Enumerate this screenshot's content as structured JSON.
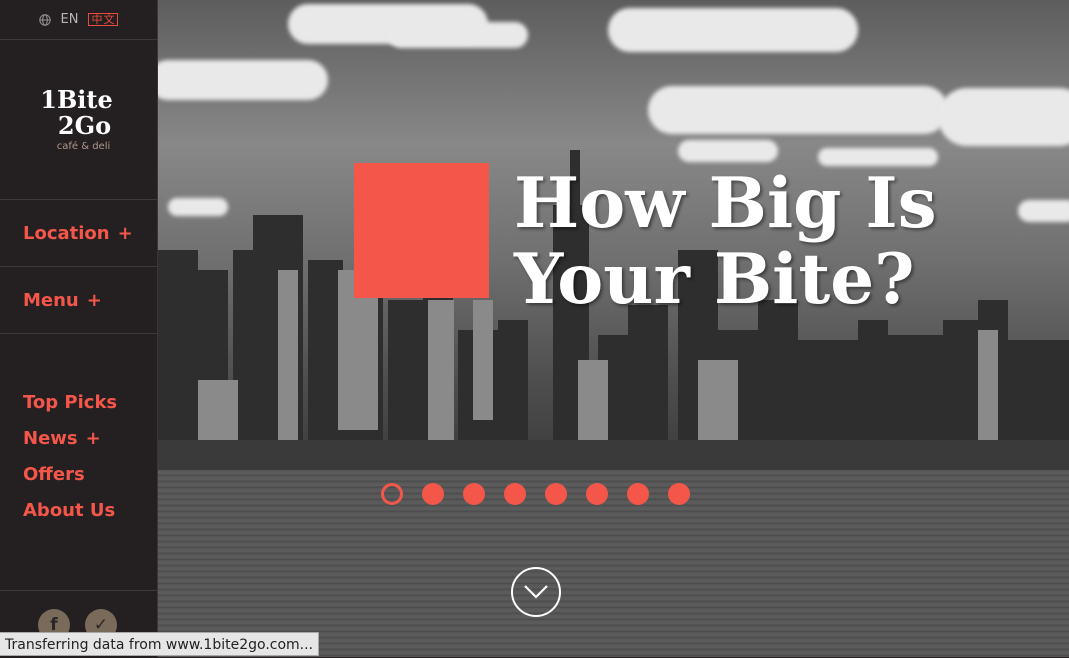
{
  "language": {
    "current": "EN",
    "alternate": "中文",
    "globe_icon": "globe-icon"
  },
  "logo": {
    "line1": "1Bite",
    "line2": "2Go",
    "tagline": "café & deli"
  },
  "nav": {
    "main": [
      {
        "label": "Location",
        "expander": "+"
      },
      {
        "label": "Menu",
        "expander": "+"
      }
    ],
    "sub": [
      {
        "label": "Top Picks",
        "expander": ""
      },
      {
        "label": "News",
        "expander": "+"
      },
      {
        "label": "Offers",
        "expander": ""
      },
      {
        "label": "About Us",
        "expander": ""
      }
    ]
  },
  "social": [
    {
      "icon": "facebook-icon",
      "glyph": "f"
    },
    {
      "icon": "foursquare-icon",
      "glyph": "✓"
    }
  ],
  "hero": {
    "headline_line1": "How Big Is",
    "headline_line2": "Your Bite?",
    "slide_count": 8,
    "active_slide": 1,
    "scroll_icon": "chevron-down-icon"
  },
  "status_bar": "Transferring data from www.1bite2go.com...",
  "colors": {
    "accent": "#f4574a",
    "sidebar": "#241f20",
    "text_light": "#ffffff"
  }
}
